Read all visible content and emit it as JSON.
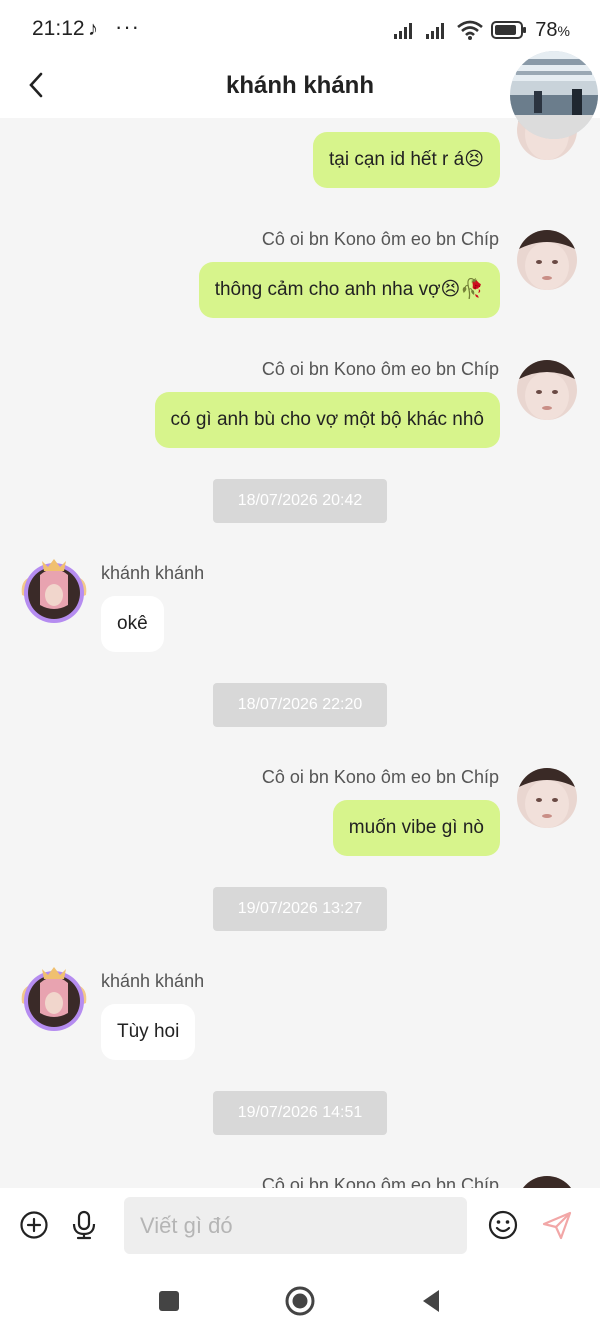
{
  "status": {
    "time": "21:12",
    "battery": "78",
    "battery_unit": "%",
    "more": "···"
  },
  "header": {
    "title": "khánh khánh"
  },
  "messages": {
    "m1": {
      "text": "tại cạn id hết r á😣"
    },
    "m2": {
      "sender": "Cô oi bn Kono ôm eo bn Chíp",
      "text": "thông cảm cho anh nha vợ😣🥀"
    },
    "m3": {
      "sender": "Cô oi bn Kono ôm eo bn Chíp",
      "text": "có gì anh bù cho vợ một bộ khác nhô"
    },
    "t1": "18/07/2026 20:42",
    "m4": {
      "sender": "khánh khánh",
      "text": "okê"
    },
    "t2": "18/07/2026 22:20",
    "m5": {
      "sender": "Cô oi bn Kono ôm eo bn Chíp",
      "text": "muốn vibe gì nò"
    },
    "t3": "19/07/2026 13:27",
    "m6": {
      "sender": "khánh khánh",
      "text": "Tùy hoi"
    },
    "t4": "19/07/2026 14:51",
    "m7": {
      "sender": "Cô oi bn Kono ôm eo bn Chíp"
    }
  },
  "composer": {
    "placeholder": "Viết gì đó"
  },
  "colors": {
    "bubble_out": "#d7f48c",
    "bubble_in": "#ffffff",
    "background": "#f5f5f5",
    "send": "#f2a7a7"
  },
  "icons": [
    "back-icon",
    "tiktok-icon",
    "signal-icon",
    "wifi-icon",
    "battery-icon",
    "add-icon",
    "mic-icon",
    "emoji-icon",
    "send-icon",
    "nav-recents-icon",
    "nav-home-icon",
    "nav-back-icon"
  ]
}
